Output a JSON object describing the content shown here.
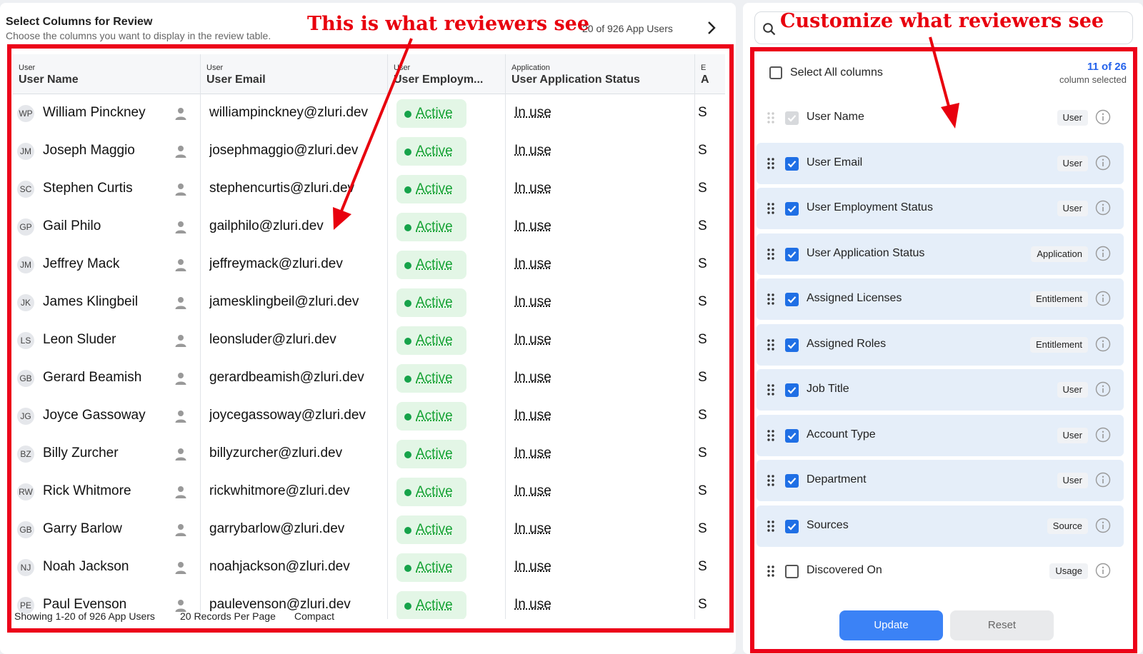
{
  "header": {
    "title": "Select Columns for Review",
    "subtitle": "Choose the columns you want to display in the review table.",
    "count": "20 of 926 App Users"
  },
  "callouts": {
    "left": "This is what reviewers see",
    "right": "Customize what reviewers see"
  },
  "colors": {
    "accent": "#2563eb",
    "callout": "#e8000e",
    "active": "#15a234"
  },
  "table": {
    "columns": [
      {
        "category": "User",
        "name": "User Name"
      },
      {
        "category": "User",
        "name": "User Email"
      },
      {
        "category": "User",
        "name": "User Employm..."
      },
      {
        "category": "Application",
        "name": "User Application Status"
      },
      {
        "category": "E",
        "name": "A"
      }
    ],
    "rows": [
      {
        "initials": "WP",
        "name": "William Pinckney",
        "email": "williampinckney@zluri.dev",
        "status": "Active",
        "app_status": "In use",
        "next": "S"
      },
      {
        "initials": "JM",
        "name": "Joseph Maggio",
        "email": "josephmaggio@zluri.dev",
        "status": "Active",
        "app_status": "In use",
        "next": "S"
      },
      {
        "initials": "SC",
        "name": "Stephen Curtis",
        "email": "stephencurtis@zluri.dev",
        "status": "Active",
        "app_status": "In use",
        "next": "S"
      },
      {
        "initials": "GP",
        "name": "Gail Philo",
        "email": "gailphilo@zluri.dev",
        "status": "Active",
        "app_status": "In use",
        "next": "S"
      },
      {
        "initials": "JM",
        "name": "Jeffrey Mack",
        "email": "jeffreymack@zluri.dev",
        "status": "Active",
        "app_status": "In use",
        "next": "S"
      },
      {
        "initials": "JK",
        "name": "James Klingbeil",
        "email": "jamesklingbeil@zluri.dev",
        "status": "Active",
        "app_status": "In use",
        "next": "S"
      },
      {
        "initials": "LS",
        "name": "Leon Sluder",
        "email": "leonsluder@zluri.dev",
        "status": "Active",
        "app_status": "In use",
        "next": "S"
      },
      {
        "initials": "GB",
        "name": "Gerard Beamish",
        "email": "gerardbeamish@zluri.dev",
        "status": "Active",
        "app_status": "In use",
        "next": "S"
      },
      {
        "initials": "JG",
        "name": "Joyce Gassoway",
        "email": "joycegassoway@zluri.dev",
        "status": "Active",
        "app_status": "In use",
        "next": "S"
      },
      {
        "initials": "BZ",
        "name": "Billy Zurcher",
        "email": "billyzurcher@zluri.dev",
        "status": "Active",
        "app_status": "In use",
        "next": "S"
      },
      {
        "initials": "RW",
        "name": "Rick Whitmore",
        "email": "rickwhitmore@zluri.dev",
        "status": "Active",
        "app_status": "In use",
        "next": "S"
      },
      {
        "initials": "GB",
        "name": "Garry Barlow",
        "email": "garrybarlow@zluri.dev",
        "status": "Active",
        "app_status": "In use",
        "next": "S"
      },
      {
        "initials": "NJ",
        "name": "Noah Jackson",
        "email": "noahjackson@zluri.dev",
        "status": "Active",
        "app_status": "In use",
        "next": "S"
      },
      {
        "initials": "PE",
        "name": "Paul Evenson",
        "email": "paulevenson@zluri.dev",
        "status": "Active",
        "app_status": "In use",
        "next": "S"
      }
    ],
    "footer": {
      "showing": "Showing 1-20 of 926 App Users",
      "per_page": "20 Records Per Page",
      "density": "Compact"
    }
  },
  "panel": {
    "search_icon": "search-icon",
    "select_all_label": "Select All columns",
    "count_main": "11 of 26",
    "count_sub": "column selected",
    "columns": [
      {
        "label": "User Name",
        "tag": "User",
        "state": "disabled",
        "draggable": false
      },
      {
        "label": "User Email",
        "tag": "User",
        "state": "checked",
        "draggable": true
      },
      {
        "label": "User Employment Status",
        "tag": "User",
        "state": "checked",
        "draggable": true
      },
      {
        "label": "User Application Status",
        "tag": "Application",
        "state": "checked",
        "draggable": true
      },
      {
        "label": "Assigned Licenses",
        "tag": "Entitlement",
        "state": "checked",
        "draggable": true
      },
      {
        "label": "Assigned Roles",
        "tag": "Entitlement",
        "state": "checked",
        "draggable": true
      },
      {
        "label": "Job Title",
        "tag": "User",
        "state": "checked",
        "draggable": true
      },
      {
        "label": "Account Type",
        "tag": "User",
        "state": "checked",
        "draggable": true
      },
      {
        "label": "Department",
        "tag": "User",
        "state": "checked",
        "draggable": true
      },
      {
        "label": "Sources",
        "tag": "Source",
        "state": "checked",
        "draggable": true
      },
      {
        "label": "Discovered On",
        "tag": "Usage",
        "state": "unchecked",
        "draggable": true
      }
    ],
    "update_label": "Update",
    "reset_label": "Reset"
  }
}
